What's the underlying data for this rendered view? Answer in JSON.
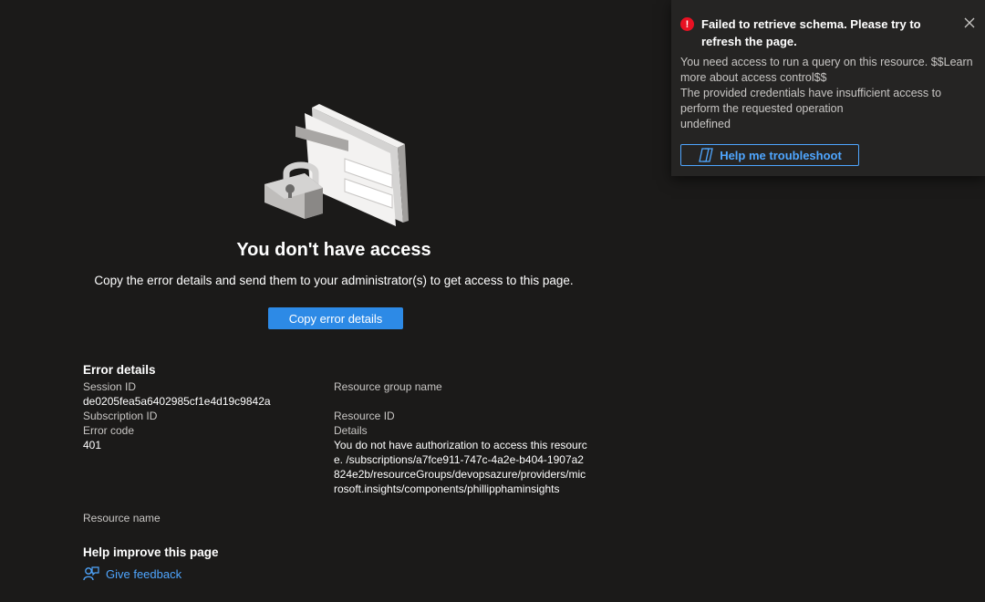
{
  "main": {
    "illustration_icon": "padlock-and-card-illustration",
    "title": "You don't have access",
    "subtitle": "Copy the error details and send them to your administrator(s) to get access to this page.",
    "copy_button_label": "Copy error details"
  },
  "error_details": {
    "heading": "Error details",
    "session_id_label": "Session ID",
    "session_id_value": "de0205fea5a6402985cf1e4d19c9842a",
    "subscription_id_label": "Subscription ID",
    "error_code_label": "Error code",
    "error_code_value": "401",
    "resource_name_label": "Resource name",
    "resource_group_label": "Resource group name",
    "resource_id_label": "Resource ID",
    "details_label": "Details",
    "details_value": "You do not have authorization to access this resource. /subscriptions/a7fce911-747c-4a2e-b404-1907a2824e2b/resourceGroups/devopsazure/providers/microsoft.insights/components/phillipphaminsights"
  },
  "help": {
    "heading": "Help improve this page",
    "feedback_label": "Give feedback",
    "feedback_icon": "feedback-person-icon"
  },
  "toast": {
    "status_icon": "error-icon",
    "title": "Failed to retrieve schema. Please try to refresh the page.",
    "body_lines": [
      "You need access to run a query on this resource. $$Learn more about access control$$",
      "The provided credentials have insufficient access to perform the requested operation",
      "undefined"
    ],
    "troubleshoot_label": "Help me troubleshoot",
    "troubleshoot_icon": "copilot-icon",
    "close_icon": "close-icon"
  },
  "colors": {
    "background": "#1b1a19",
    "toast_background": "#252423",
    "accent": "#2d8ae6",
    "link": "#4fa6ff",
    "error": "#e81123"
  }
}
